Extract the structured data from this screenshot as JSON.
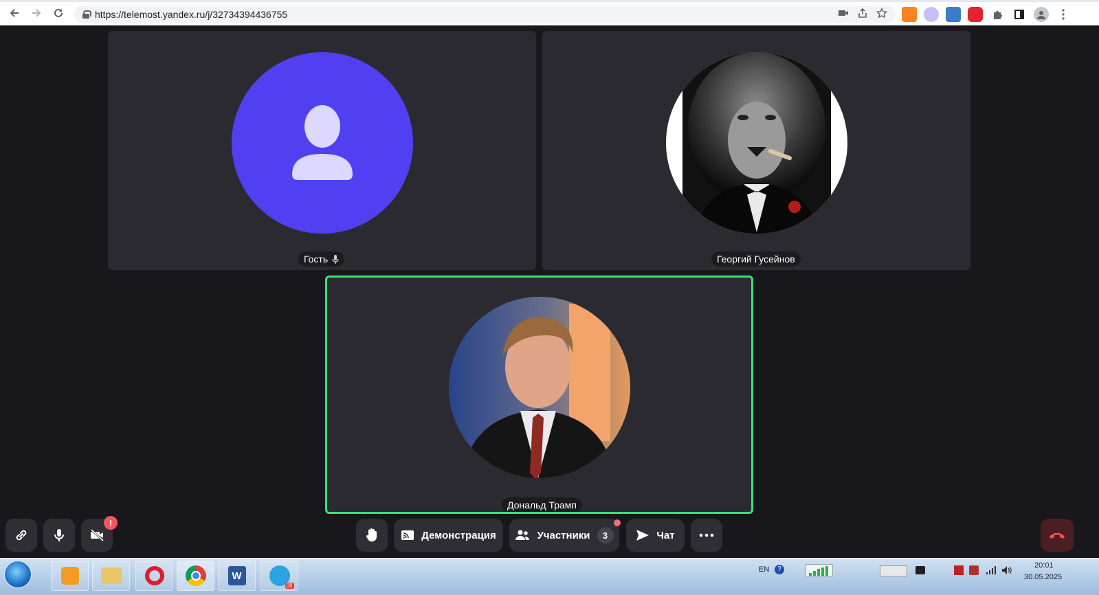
{
  "browser": {
    "url": "https://telemost.yandex.ru/j/32734394436755"
  },
  "participants": [
    {
      "name": "Гость",
      "muted_icon": "microphone-icon"
    },
    {
      "name": "Георгий Гусейнов"
    },
    {
      "name": "Дональд Трамп",
      "speaking": true
    }
  ],
  "controls": {
    "demo_label": "Демонстрация",
    "participants_label": "Участники",
    "participants_count": "3",
    "chat_label": "Чат",
    "camera_alert": "!"
  },
  "colors": {
    "background": "#18181c",
    "tile": "#2b2a30",
    "guest_avatar": "#5140f2",
    "active_border": "#3be07a",
    "hangup": "#4a1e22"
  },
  "taskbar": {
    "language": "EN",
    "time": "20:01",
    "date": "30.05.2025",
    "telegram_badge": "08"
  }
}
